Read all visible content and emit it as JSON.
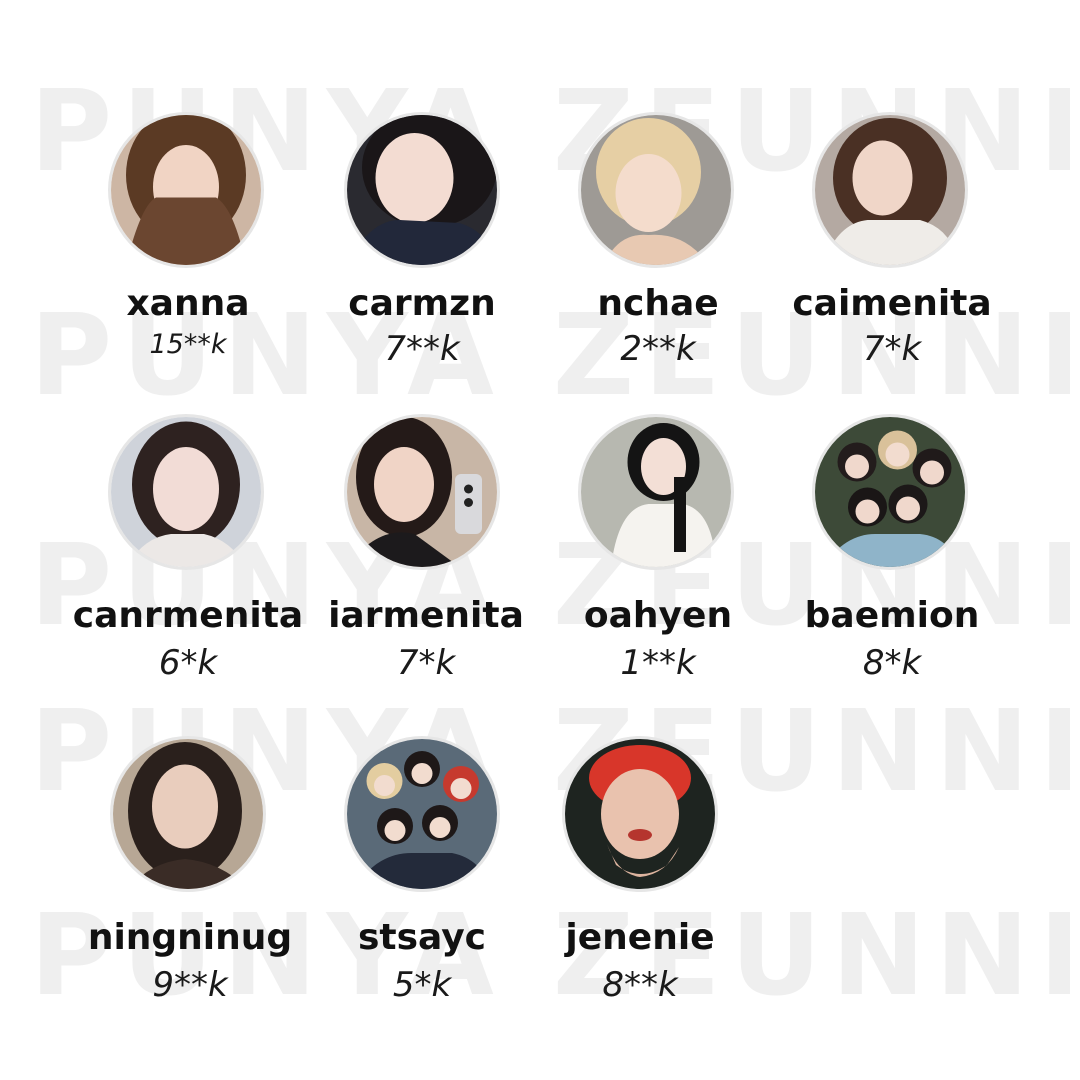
{
  "watermark": {
    "text": "PUNYA ZEUNNIE"
  },
  "profiles": [
    {
      "name": "xanna",
      "count": "15**k"
    },
    {
      "name": "carmzn",
      "count": "7**k"
    },
    {
      "name": "nchae",
      "count": "2**k"
    },
    {
      "name": "caimenita",
      "count": "7*k"
    },
    {
      "name": "canrmenita",
      "count": "6*k"
    },
    {
      "name": "iarmenita",
      "count": "7*k"
    },
    {
      "name": "oahyen",
      "count": "1**k"
    },
    {
      "name": "baemion",
      "count": "8*k"
    },
    {
      "name": "ningninug",
      "count": "9**k"
    },
    {
      "name": "stsayc",
      "count": "5*k"
    },
    {
      "name": "jenenie",
      "count": "8**k"
    }
  ]
}
